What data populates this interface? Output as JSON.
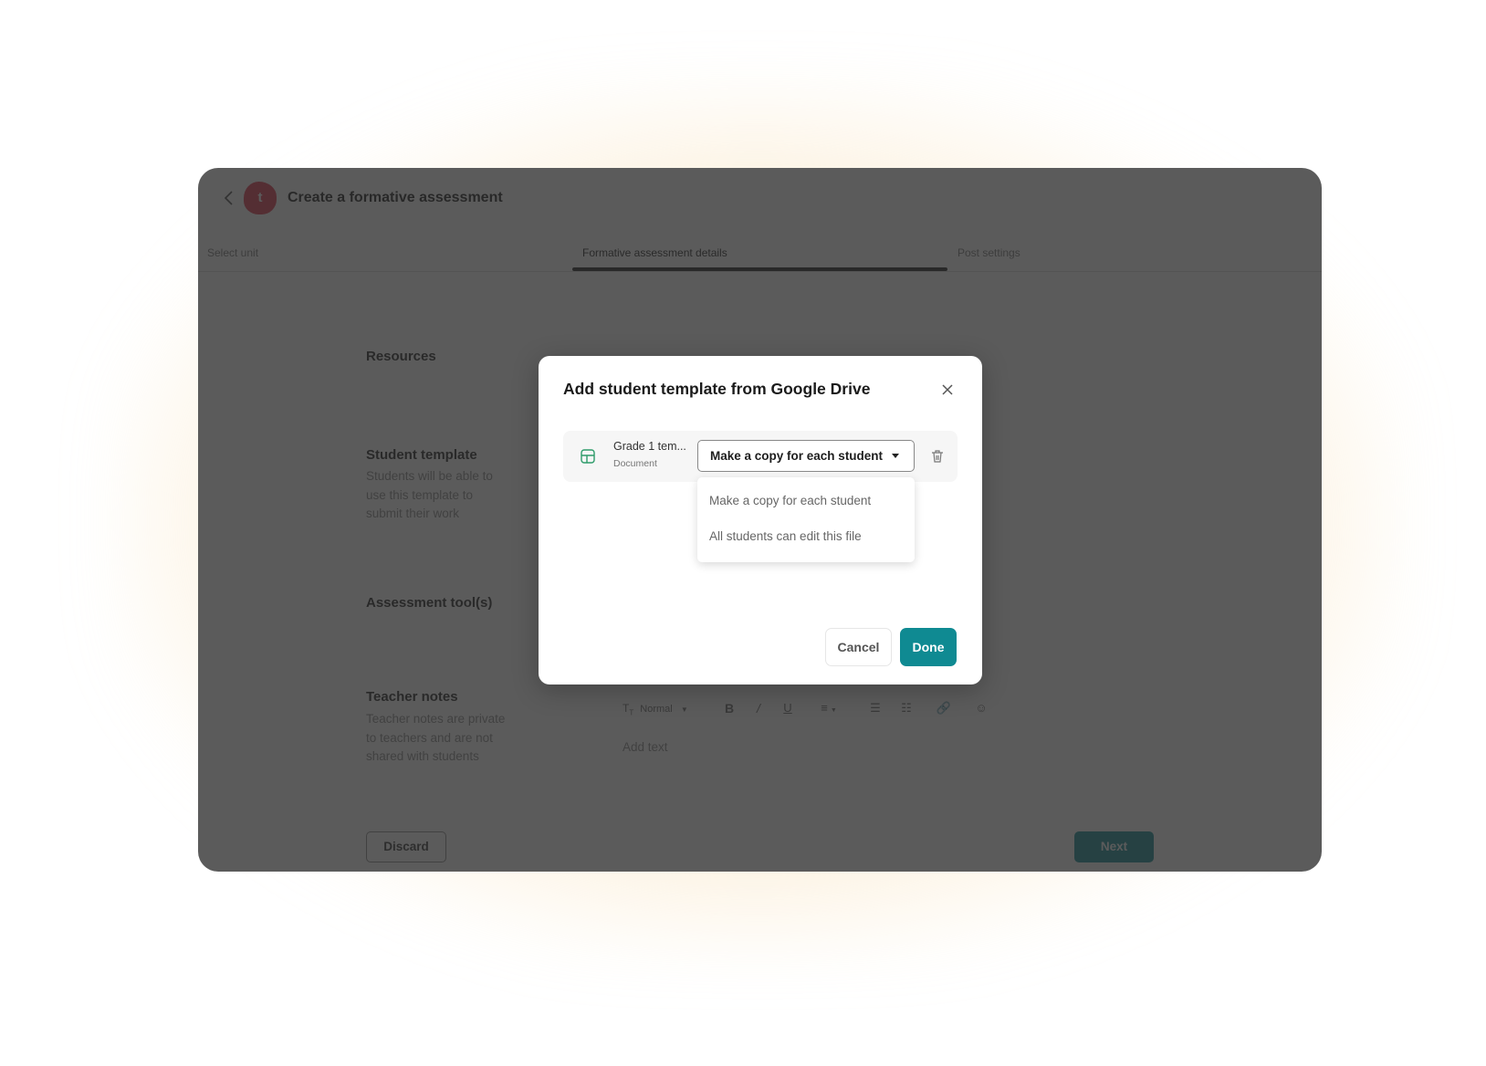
{
  "header": {
    "back_icon": "chevron-left-icon",
    "logo_letter": "t",
    "title": "Create a formative assessment"
  },
  "steps": [
    {
      "label": "Select unit",
      "active": false
    },
    {
      "label": "Formative assessment details",
      "active": true
    },
    {
      "label": "Post settings",
      "active": false
    }
  ],
  "sections": {
    "resources": {
      "title": "Resources"
    },
    "student_template": {
      "title": "Student template",
      "description": "Students will be able to use this template to submit their work"
    },
    "assessment_tools": {
      "title": "Assessment tool(s)"
    },
    "teacher_notes": {
      "title": "Teacher notes",
      "description": "Teacher notes are private to teachers and are not shared with students"
    }
  },
  "editor": {
    "text_style": "Normal",
    "placeholder": "Add text",
    "tools": [
      "text-style-icon",
      "bold-icon",
      "italic-icon",
      "underline-icon",
      "align-icon",
      "bullet-list-icon",
      "numbered-list-icon",
      "link-icon",
      "emoji-icon"
    ]
  },
  "footer": {
    "discard_label": "Discard",
    "next_label": "Next"
  },
  "modal": {
    "title": "Add student template from Google Drive",
    "file": {
      "name": "Grade 1 tem...",
      "type": "Document",
      "icon": "sheet-table-icon"
    },
    "select": {
      "value": "Make a copy for each student",
      "options": [
        "Make a copy for each student",
        "All students can edit this file"
      ]
    },
    "cancel_label": "Cancel",
    "done_label": "Done"
  },
  "colors": {
    "accent": "#0f8a92",
    "logo": "#e0344a",
    "file_icon": "#2e9c6a"
  }
}
